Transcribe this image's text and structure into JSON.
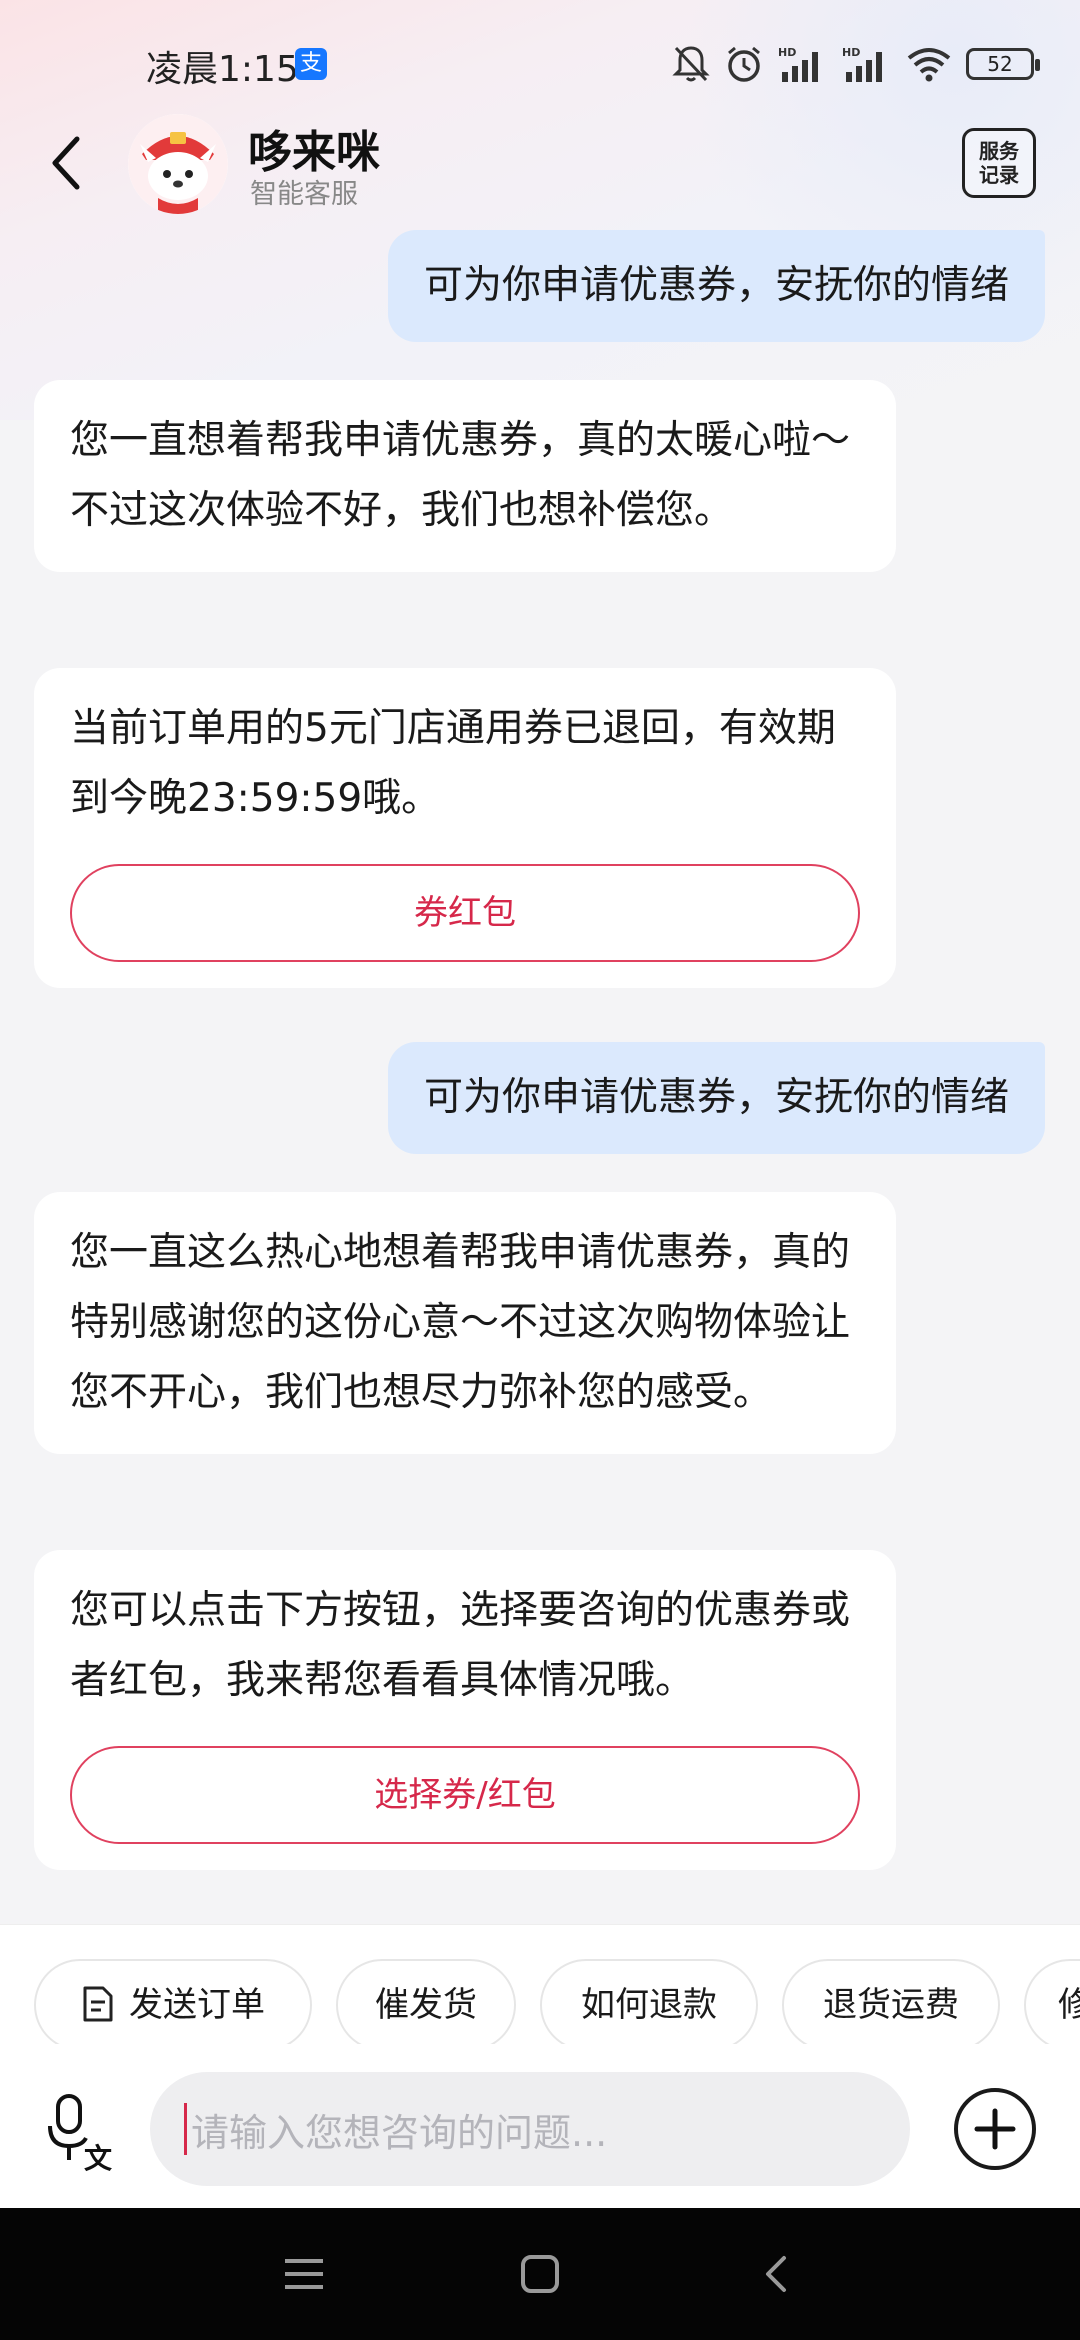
{
  "status_bar": {
    "time": "凌晨1:15",
    "alipay_badge": "支",
    "battery": "52",
    "icons": [
      "mute-bell-icon",
      "alarm-icon",
      "hd-signal-icon",
      "hd-signal-icon",
      "wifi-icon",
      "battery-icon"
    ]
  },
  "header": {
    "name": "哆来咪",
    "subtitle": "智能客服",
    "service_record_line1": "服务",
    "service_record_line2": "记录"
  },
  "messages": [
    {
      "from": "user",
      "text": "可为你申请优惠券，安抚你的情绪"
    },
    {
      "from": "bot",
      "text": "您一直想着帮我申请优惠券，真的太暖心啦～不过这次体验不好，我们也想补偿您。"
    },
    {
      "from": "bot",
      "text": "当前订单用的5元门店通用券已退回，有效期到今晚23:59:59哦。",
      "button": "券红包"
    },
    {
      "from": "user",
      "text": "可为你申请优惠券，安抚你的情绪"
    },
    {
      "from": "bot",
      "text": "您一直这么热心地想着帮我申请优惠券，真的特别感谢您的这份心意～不过这次购物体验让您不开心，我们也想尽力弥补您的感受。"
    },
    {
      "from": "bot",
      "text": "您可以点击下方按钮，选择要咨询的优惠券或者红包，我来帮您看看具体情况哦。",
      "button": "选择券/红包"
    }
  ],
  "quick_replies": [
    "发送订单",
    "催发货",
    "如何退款",
    "退货运费",
    "修"
  ],
  "input": {
    "placeholder": "请输入您想咨询的问题...",
    "voice_label": "文"
  },
  "colors": {
    "accent": "#d6284a",
    "user_bubble": "#dbe9fd",
    "bot_bubble": "#ffffff",
    "background": "#f4f4f6"
  }
}
